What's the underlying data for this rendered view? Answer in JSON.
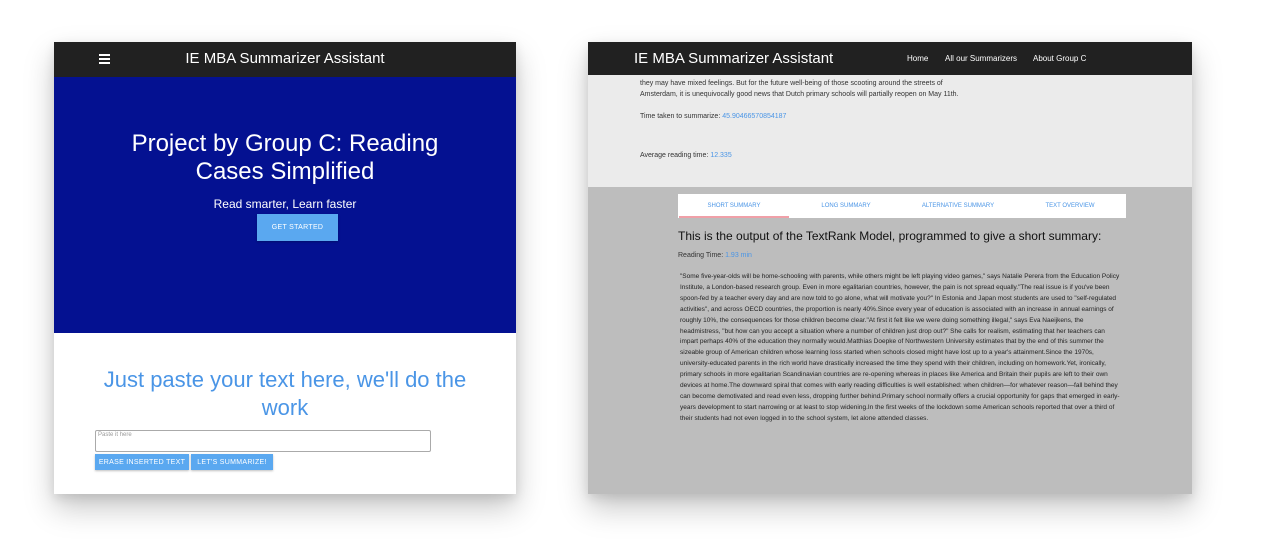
{
  "left": {
    "app_title": "IE MBA Summarizer Assistant",
    "hero_title": "Project by Group C: Reading Cases Simplified",
    "hero_subtitle": "Read smarter, Learn faster",
    "get_started_label": "GET STARTED",
    "paste_title": "Just paste your text here, we'll do the work",
    "input_placeholder": "Paste it here",
    "erase_label": "ERASE INSERTED TEXT",
    "summarize_label": "LET'S SUMMARIZE!",
    "menu_icon": "hamburger-menu-icon"
  },
  "right": {
    "app_title": "IE MBA Summarizer Assistant",
    "nav": [
      "Home",
      "All our Summarizers",
      "About Group C"
    ],
    "prev_text": "they may have mixed feelings. But for the future well-being of those scooting around the streets of Amsterdam, it is unequivocally good news that Dutch primary schools will partially reopen on May 11th.",
    "time_taken_label": "Time taken to summarize:",
    "time_taken_value": "45.90466570854187",
    "avg_reading_label": "Average reading time:",
    "avg_reading_value": "12.335",
    "tabs": [
      "SHORT SUMMARY",
      "LONG SUMMARY",
      "ALTERNATIVE SUMMARY",
      "TEXT OVERVIEW"
    ],
    "active_tab": "SHORT SUMMARY",
    "output_title": "This is the output of the TextRank Model, programmed to give a short summary:",
    "reading_time_label": "Reading Time:",
    "reading_time_value": "1.93 min",
    "summary_text": "\"Some five-year-olds will be home-schooling with parents, while others might be left playing video games,\" says Natalie Perera from the Education Policy Institute, a London-based research group. Even in more egalitarian countries, however, the pain is not spread equally.\"The real issue is if you've been spoon-fed by a teacher every day and are now told to go alone, what will motivate you?\" In Estonia and Japan most students are used to \"self-regulated activities\", and across OECD countries, the proportion is nearly 40%.Since every year of education is associated with an increase in annual earnings of roughly 10%, the consequences for those children become clear.\"At first it felt like we were doing something illegal,\" says Eva Naeijkens, the headmistress, \"but how can you accept a situation where a number of children just drop out?\" She calls for realism, estimating that her teachers can impart perhaps 40% of the education they normally would.Matthias Doepke of Northwestern University estimates that by the end of this summer the sizeable group of American children whose learning loss started when schools closed might have lost up to a year's attainment.Since the 1970s, university-educated parents in the rich world have drastically increased the time they spend with their children, including on homework.Yet, ironically, primary schools in more egalitarian Scandinavian countries are re-opening whereas in places like America and Britain their pupils are left to their own devices at home.The downward spiral that comes with early reading difficulties is well established: when children—for whatever reason—fall behind they can become demotivated and read even less, dropping further behind.Primary school normally offers a crucial opportunity for gaps that emerged in early-years development to start narrowing or at least to stop widening.In the first weeks of the lockdown some American schools reported that over a third of their students had not even logged in to the school system, let alone attended classes."
  },
  "colors": {
    "nav_bg": "#212121",
    "hero_bg": "#041191",
    "accent_blue": "#5aa8f0",
    "title_blue": "#4a95e6",
    "right_bg": "#bdbdbd",
    "right_top_bg": "#ebebeb"
  }
}
